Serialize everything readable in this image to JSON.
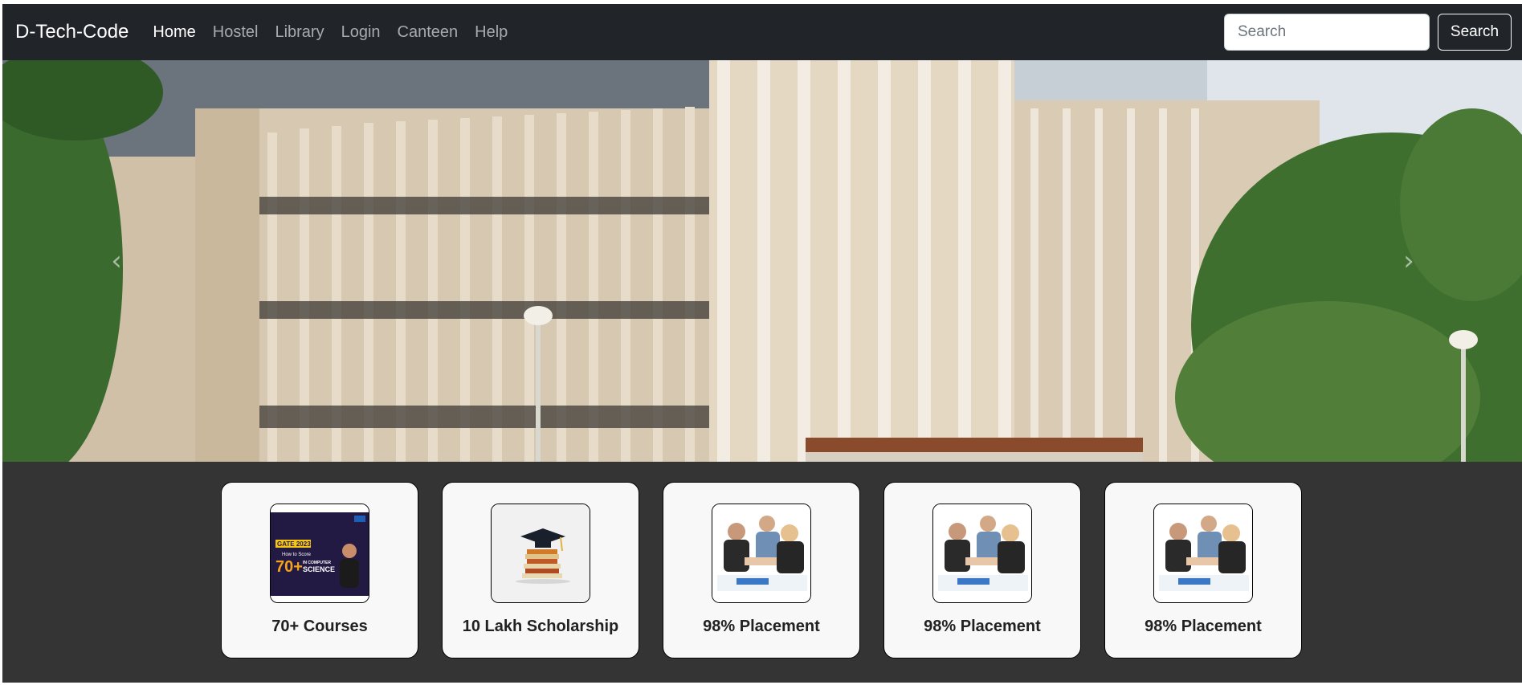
{
  "navbar": {
    "brand": "D-Tech-Code",
    "links": [
      {
        "label": "Home",
        "active": true
      },
      {
        "label": "Hostel",
        "active": false
      },
      {
        "label": "Library",
        "active": false
      },
      {
        "label": "Login",
        "active": false
      },
      {
        "label": "Canteen",
        "active": false
      },
      {
        "label": "Help",
        "active": false
      }
    ],
    "search": {
      "placeholder": "Search",
      "value": "",
      "button_label": "Search"
    }
  },
  "hero": {
    "image_name": "campus-building-photo",
    "prev_icon": "chevron-left-icon",
    "next_icon": "chevron-right-icon"
  },
  "cards": [
    {
      "title": "70+ Courses",
      "image_name": "gate-course-thumbnail",
      "thumb_text": {
        "l1": "GATE 2023",
        "l2": "How to Score",
        "big": "70+",
        "l3": "IN COMPUTER",
        "l4": "SCIENCE"
      }
    },
    {
      "title": "10 Lakh Scholarship",
      "image_name": "graduation-cap-books-image"
    },
    {
      "title": "98% Placement",
      "image_name": "business-handshake-image"
    },
    {
      "title": "98% Placement",
      "image_name": "business-handshake-image"
    },
    {
      "title": "98% Placement",
      "image_name": "business-handshake-image"
    }
  ]
}
